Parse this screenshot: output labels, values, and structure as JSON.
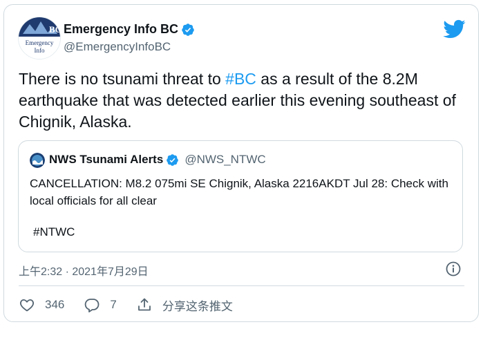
{
  "author": {
    "display_name": "Emergency Info BC",
    "handle": "@EmergencyInfoBC",
    "avatar_text_top": "BC",
    "avatar_text_line1": "Emergency",
    "avatar_text_line2": "Info"
  },
  "tweet": {
    "text_before": "There is no tsunami threat to ",
    "hashtag": "#BC",
    "text_after": " as a result of the 8.2M earthquake that was detected earlier this evening southeast of Chignik, Alaska."
  },
  "quoted": {
    "display_name": "NWS Tsunami Alerts",
    "handle": "@NWS_NTWC",
    "text": "CANCELLATION:  M8.2 075mi SE Chignik, Alaska 2216AKDT Jul 28: Check with local officials for all clear",
    "tag": "#NTWC"
  },
  "timestamp": "上午2:32 · 2021年7月29日",
  "actions": {
    "like_count": "346",
    "reply_count": "7",
    "share_label": "分享这条推文"
  },
  "colors": {
    "accent": "#1d9bf0",
    "text": "#0f1419",
    "muted": "#536471",
    "border": "#cfd9de"
  }
}
